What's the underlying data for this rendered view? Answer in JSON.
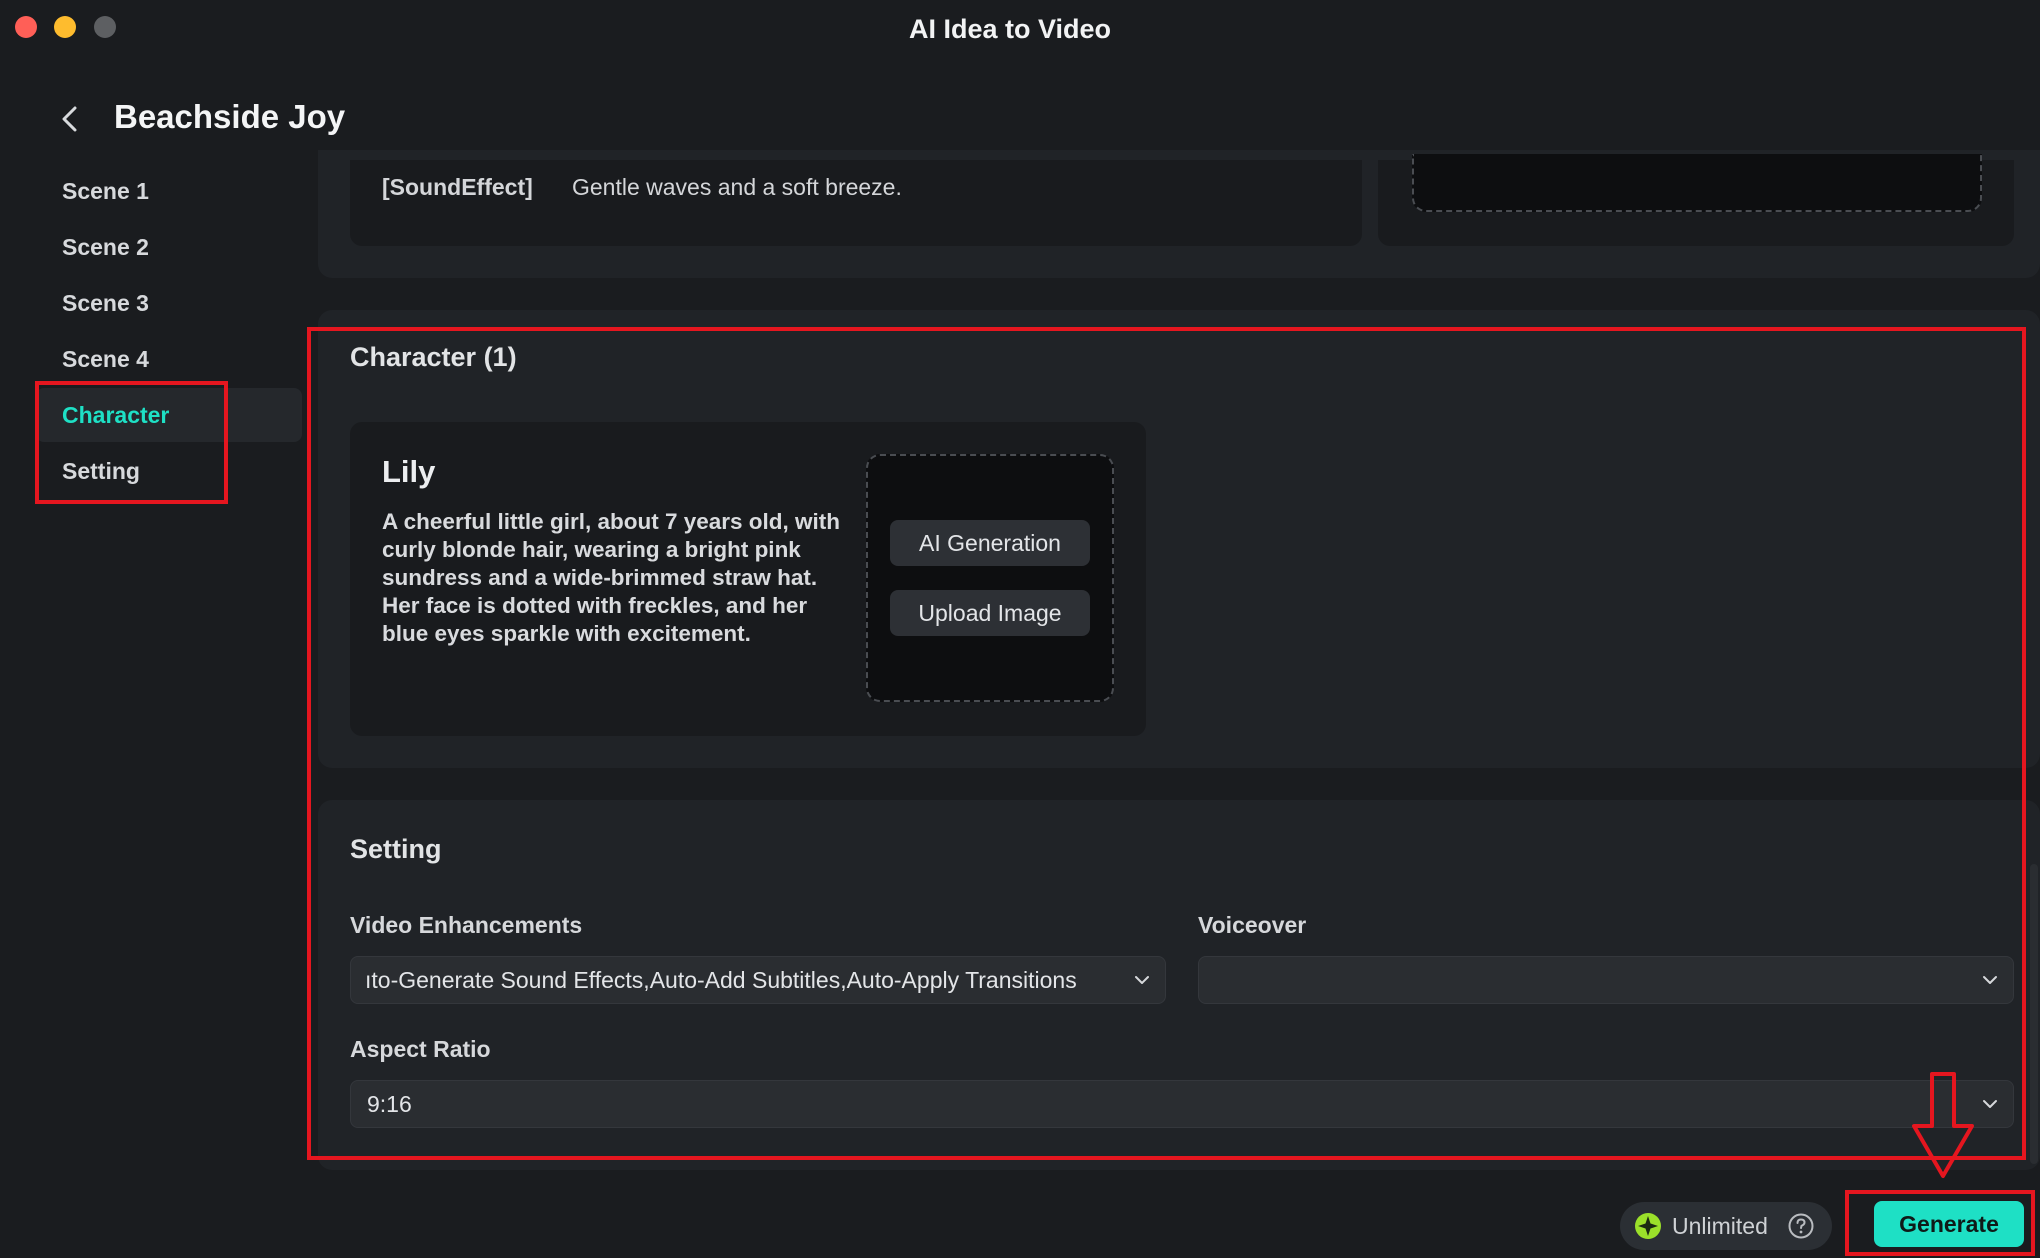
{
  "window": {
    "title": "AI Idea to Video"
  },
  "header": {
    "title": "Beachside Joy"
  },
  "sidebar": {
    "items": [
      {
        "label": "Scene 1"
      },
      {
        "label": "Scene 2"
      },
      {
        "label": "Scene 3"
      },
      {
        "label": "Scene 4"
      },
      {
        "label": "Character",
        "active": true
      },
      {
        "label": "Setting"
      }
    ]
  },
  "scene_card": {
    "tag": "[SoundEffect]",
    "text": "Gentle waves and a soft breeze."
  },
  "character": {
    "section_title": "Character (1)",
    "name": "Lily",
    "description": "A cheerful little girl, about 7 years old, with curly blonde hair, wearing a bright pink sundress and a wide-brimmed straw hat. Her face is dotted with freckles, and her blue eyes sparkle with excitement.",
    "ai_generation_label": "AI Generation",
    "upload_label": "Upload Image"
  },
  "setting": {
    "section_title": "Setting",
    "video_enhancements": {
      "label": "Video Enhancements",
      "value": "ıto-Generate Sound Effects,Auto-Add Subtitles,Auto-Apply Transitions"
    },
    "voiceover": {
      "label": "Voiceover",
      "value": ""
    },
    "aspect_ratio": {
      "label": "Aspect Ratio",
      "value": "9:16"
    }
  },
  "footer": {
    "unlimited_label": "Unlimited",
    "generate_label": "Generate"
  },
  "colors": {
    "accent": "#1ee0c5",
    "annotation": "#e5161f",
    "background": "#1a1c1f"
  }
}
